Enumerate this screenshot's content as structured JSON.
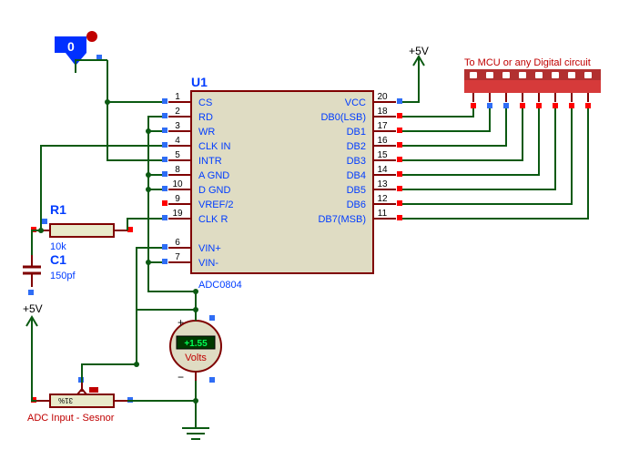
{
  "power": {
    "plus5v_top": "+5V",
    "plus5v_left": "+5V"
  },
  "header": {
    "label": "To MCU or any Digital circuit"
  },
  "chip": {
    "ref": "U1",
    "part": "ADC0804",
    "pins_left": [
      {
        "no": "1",
        "name": "CS"
      },
      {
        "no": "2",
        "name": "RD"
      },
      {
        "no": "3",
        "name": "WR"
      },
      {
        "no": "4",
        "name": "CLK IN"
      },
      {
        "no": "5",
        "name": "INTR"
      },
      {
        "no": "8",
        "name": "A GND"
      },
      {
        "no": "10",
        "name": "D GND"
      },
      {
        "no": "9",
        "name": "VREF/2"
      },
      {
        "no": "19",
        "name": "CLK R"
      }
    ],
    "pins_left_lower": [
      {
        "no": "6",
        "name": "VIN+"
      },
      {
        "no": "7",
        "name": "VIN-"
      }
    ],
    "pins_right": [
      {
        "no": "20",
        "name": "VCC"
      },
      {
        "no": "18",
        "name": "DB0(LSB)"
      },
      {
        "no": "17",
        "name": "DB1"
      },
      {
        "no": "16",
        "name": "DB2"
      },
      {
        "no": "15",
        "name": "DB3"
      },
      {
        "no": "14",
        "name": "DB4"
      },
      {
        "no": "13",
        "name": "DB5"
      },
      {
        "no": "12",
        "name": "DB6"
      },
      {
        "no": "11",
        "name": "DB7(MSB)"
      }
    ]
  },
  "r1": {
    "ref": "R1",
    "value": "10k"
  },
  "c1": {
    "ref": "C1",
    "value": "150pf"
  },
  "probe": {
    "label": "0"
  },
  "meter": {
    "value": "+1.55",
    "unit": "Volts"
  },
  "pot": {
    "value": "31%",
    "label": "ADC Input - Sesnor"
  },
  "chart_data": {
    "type": "circuit",
    "component": "ADC0804",
    "pin_connections": {
      "CS": "tied to INTR / DB7 bus node, pulled low",
      "RD": "tied to WR, A GND, D GND → all to GND",
      "WR": "tied to RD → GND",
      "CLK IN": "R1(10k) + C1(150pf) RC oscillator node",
      "INTR": "tied back to CS",
      "A GND": "GND",
      "D GND": "GND",
      "VREF/2": "open",
      "CLK R": "other side of R1 / RC node",
      "VIN+": "wiper of pot (ADC Input - Sensor) from +5V, reads +1.55 V",
      "VIN-": "GND",
      "VCC": "+5V",
      "DB0..DB7": "8-pin header → To MCU or any Digital circuit"
    },
    "measured_input_voltage": 1.55,
    "pot_position_percent": 31
  }
}
